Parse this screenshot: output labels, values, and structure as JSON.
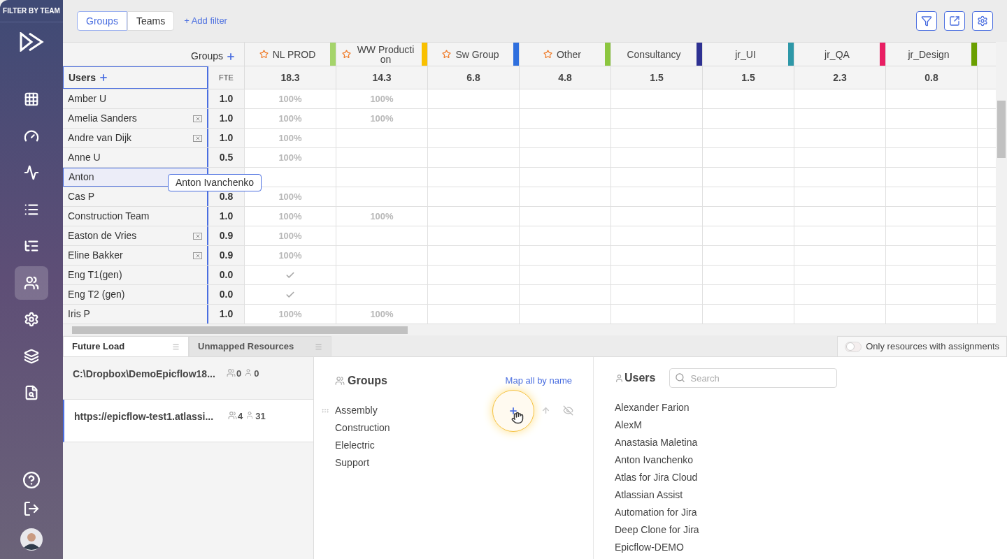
{
  "sidebar": {
    "header": "FILTER BY TEAM",
    "items": [
      {
        "selected": false
      },
      {
        "selected": false
      },
      {
        "selected": false
      },
      {
        "selected": false
      },
      {
        "selected": false
      },
      {
        "selected": true
      },
      {
        "selected": false
      },
      {
        "selected": false
      },
      {
        "selected": false
      }
    ]
  },
  "toolbar": {
    "toggle": [
      {
        "label": "Groups",
        "selected": true
      },
      {
        "label": "Teams",
        "selected": false
      }
    ],
    "add_filter": "+ Add filter"
  },
  "grid": {
    "groups_label": "Groups",
    "users_label": "Users",
    "fte_label": "FTE",
    "columns": [
      {
        "name": "NL PROD",
        "starred": true,
        "color": "#a5d46a",
        "fte": "18.3"
      },
      {
        "name": "WW Production",
        "starred": true,
        "color": "#f9c000",
        "fte": "14.3"
      },
      {
        "name": "Sw Group",
        "starred": true,
        "color": "#2f6fde",
        "fte": "6.8"
      },
      {
        "name": "Other",
        "starred": true,
        "color": "#8cc63f",
        "fte": "4.8"
      },
      {
        "name": "Consultancy",
        "starred": false,
        "color": "#2e3192",
        "fte": "1.5"
      },
      {
        "name": "jr_UI",
        "starred": false,
        "color": "#2e98a8",
        "fte": "1.5"
      },
      {
        "name": "jr_QA",
        "starred": false,
        "color": "#e91e63",
        "fte": "2.3"
      },
      {
        "name": "jr_Design",
        "starred": false,
        "color": "#6a9f00",
        "fte": "0.8"
      }
    ],
    "rows": [
      {
        "name": "Amber U",
        "fte": "1.0",
        "removable": false,
        "selected": false,
        "cells": [
          {
            "kind": "percent",
            "text": "100%"
          },
          {
            "kind": "percent",
            "text": "100%"
          }
        ]
      },
      {
        "name": "Amelia Sanders",
        "fte": "1.0",
        "removable": true,
        "selected": false,
        "cells": [
          {
            "kind": "percent",
            "text": "100%"
          },
          {
            "kind": "percent",
            "text": "100%"
          }
        ]
      },
      {
        "name": "Andre van Dijk",
        "fte": "1.0",
        "removable": true,
        "selected": false,
        "cells": [
          {
            "kind": "percent",
            "text": "100%"
          }
        ]
      },
      {
        "name": "Anne U",
        "fte": "0.5",
        "removable": false,
        "selected": false,
        "cells": [
          {
            "kind": "percent",
            "text": "100%"
          }
        ]
      },
      {
        "name": "Anton",
        "removable": false,
        "selected": true
      },
      {
        "name": "Cas P",
        "fte": "0.8",
        "removable": false,
        "selected": false,
        "cells": [
          {
            "kind": "percent",
            "text": "100%"
          }
        ]
      },
      {
        "name": "Construction Team",
        "fte": "1.0",
        "removable": false,
        "selected": false,
        "cells": [
          {
            "kind": "percent",
            "text": "100%"
          },
          {
            "kind": "percent",
            "text": "100%"
          }
        ]
      },
      {
        "name": "Easton de Vries",
        "fte": "0.9",
        "removable": true,
        "selected": false,
        "cells": [
          {
            "kind": "percent",
            "text": "100%"
          }
        ]
      },
      {
        "name": "Eline Bakker",
        "fte": "0.9",
        "removable": true,
        "selected": false,
        "cells": [
          {
            "kind": "percent",
            "text": "100%"
          }
        ]
      },
      {
        "name": "Eng T1(gen)",
        "fte": "0.0",
        "removable": false,
        "selected": false,
        "cells": [
          {
            "kind": "check"
          }
        ]
      },
      {
        "name": "Eng T2 (gen)",
        "fte": "0.0",
        "removable": false,
        "selected": false,
        "cells": [
          {
            "kind": "check"
          }
        ]
      },
      {
        "name": "Iris P",
        "fte": "1.0",
        "removable": false,
        "selected": false,
        "cells": [
          {
            "kind": "percent",
            "text": "100%"
          },
          {
            "kind": "percent",
            "text": "100%"
          }
        ]
      }
    ],
    "tooltip": "Anton Ivanchenko"
  },
  "bottom": {
    "tabs": [
      {
        "label": "Future Load",
        "selected": true
      },
      {
        "label": "Unmapped Resources",
        "selected": false
      }
    ],
    "only_assignments": {
      "label": "Only resources with assignments",
      "on": false
    },
    "sources": [
      {
        "name": "C:\\Dropbox\\DemoEpicflow18...",
        "groups": "0",
        "users": "0",
        "selected": false
      },
      {
        "name": "https://epicflow-test1.atlassi...",
        "groups": "4",
        "users": "31",
        "selected": true
      }
    ],
    "groups_panel": {
      "title": "Groups",
      "map_all": "Map all by name",
      "items": [
        "Assembly",
        "Construction",
        "Elelectric",
        "Support"
      ]
    },
    "users_panel": {
      "title": "Users",
      "search_placeholder": "Search",
      "items": [
        "Alexander Farion",
        "AlexM",
        "Anastasia Maletina",
        "Anton Ivanchenko",
        "Atlas for Jira Cloud",
        "Atlassian Assist",
        "Automation for Jira",
        "Deep Clone for Jira",
        "Epicflow-DEMO"
      ]
    }
  }
}
